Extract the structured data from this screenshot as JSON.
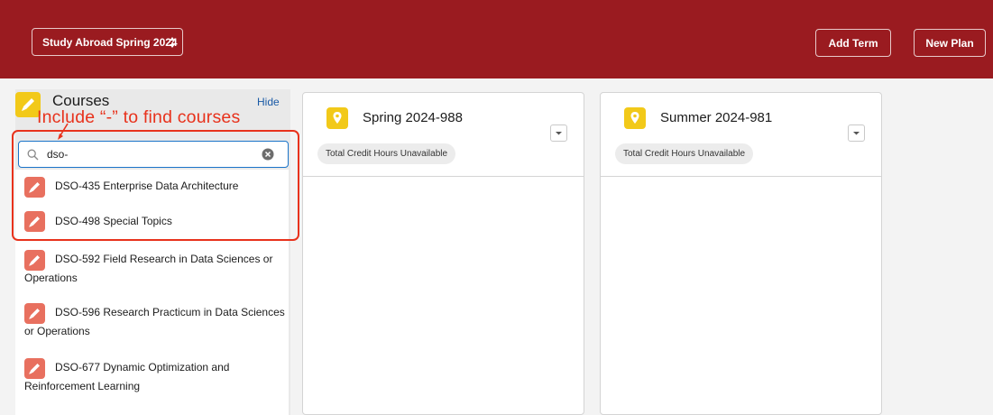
{
  "header": {
    "plan_name": "Study Abroad Spring 2024",
    "add_term_label": "Add Term",
    "new_plan_label": "New Plan",
    "background_color": "#9a1b20"
  },
  "sidebar": {
    "title": "Courses",
    "hide_label": "Hide",
    "search_value": "dso-",
    "courses": [
      {
        "label": "DSO-435 Enterprise Data Architecture"
      },
      {
        "label": "DSO-498 Special Topics"
      },
      {
        "label": "DSO-592 Field Research in Data Sciences or Operations"
      },
      {
        "label": "DSO-596 Research Practicum in Data Sciences or Operations"
      },
      {
        "label": "DSO-677 Dynamic Optimization and Reinforcement Learning"
      }
    ]
  },
  "annotation": {
    "text": "Include “-” to find courses",
    "color": "#e8321c"
  },
  "terms": [
    {
      "title": "Spring 2024-988",
      "credit_label": "Total Credit Hours Unavailable"
    },
    {
      "title": "Summer 2024-981",
      "credit_label": "Total Credit Hours Unavailable"
    }
  ],
  "icons": {
    "courses": "pencil-icon",
    "course_item": "pencil-icon",
    "term": "location-pin-icon",
    "search": "search-icon",
    "clear": "clear-icon",
    "term_menu": "chevron-down-icon",
    "plan_select": "updown-chevron-icon"
  }
}
